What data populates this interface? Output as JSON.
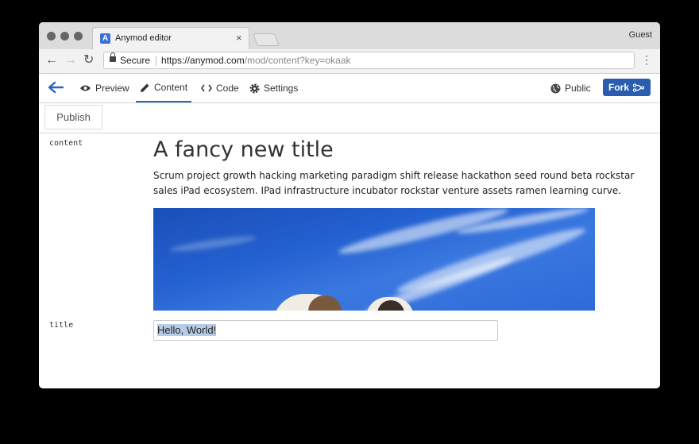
{
  "browser": {
    "tab_title": "Anymod editor",
    "tab_favicon_letter": "A",
    "tab_close": "×",
    "profile": "Guest",
    "secure_label": "Secure",
    "url_scheme": "https://",
    "url_host": "anymod.com",
    "url_path": "/mod/content?key=okaak"
  },
  "nav": {
    "preview": "Preview",
    "content": "Content",
    "code": "Code",
    "settings": "Settings",
    "public": "Public",
    "fork": "Fork",
    "accent_color": "#2563c8"
  },
  "toolbar": {
    "publish": "Publish"
  },
  "fields": {
    "content_label": "content",
    "title_label": "title",
    "content_heading": "A fancy new title",
    "content_body": "Scrum project growth hacking marketing paradigm shift release hackathon seed round beta rockstar sales iPad ecosystem. IPad infrastructure incubator rockstar venture assets ramen learning curve.",
    "title_value": "Hello, World!"
  }
}
